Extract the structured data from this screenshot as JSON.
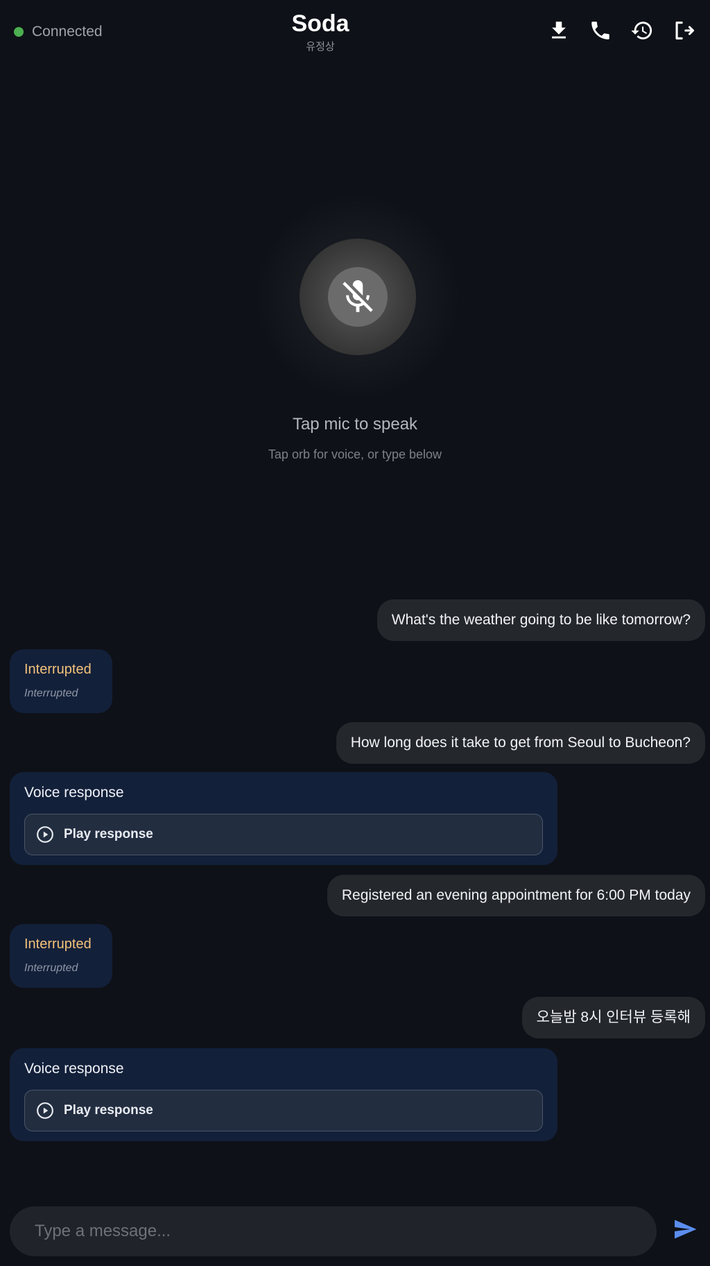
{
  "header": {
    "status_text": "Connected",
    "status_color": "#4caf50",
    "title": "Soda",
    "subtitle": "유정상",
    "icons": [
      "download-icon",
      "phone-icon",
      "history-icon",
      "logout-icon"
    ]
  },
  "orb": {
    "icon": "mic-off-icon",
    "label": "Tap mic to speak",
    "hint": "Tap orb for voice, or type below"
  },
  "messages": [
    {
      "role": "user",
      "text": "What's the weather going to be like tomorrow?"
    },
    {
      "role": "assistant",
      "kind": "interrupted",
      "title": "Interrupted",
      "note": "Interrupted"
    },
    {
      "role": "user",
      "text": "How long does it take to get from Seoul to Bucheon?"
    },
    {
      "role": "assistant",
      "kind": "voice",
      "title": "Voice response",
      "play_label": "Play response"
    },
    {
      "role": "user",
      "text": "Registered an evening appointment for 6:00 PM today"
    },
    {
      "role": "assistant",
      "kind": "interrupted",
      "title": "Interrupted",
      "note": "Interrupted"
    },
    {
      "role": "user",
      "text": "오늘밤 8시 인터뷰 등록해"
    },
    {
      "role": "assistant",
      "kind": "voice",
      "title": "Voice response",
      "play_label": "Play response"
    }
  ],
  "composer": {
    "placeholder": "Type a message...",
    "value": "",
    "send_icon": "send-icon",
    "accent": "#5b8def"
  }
}
